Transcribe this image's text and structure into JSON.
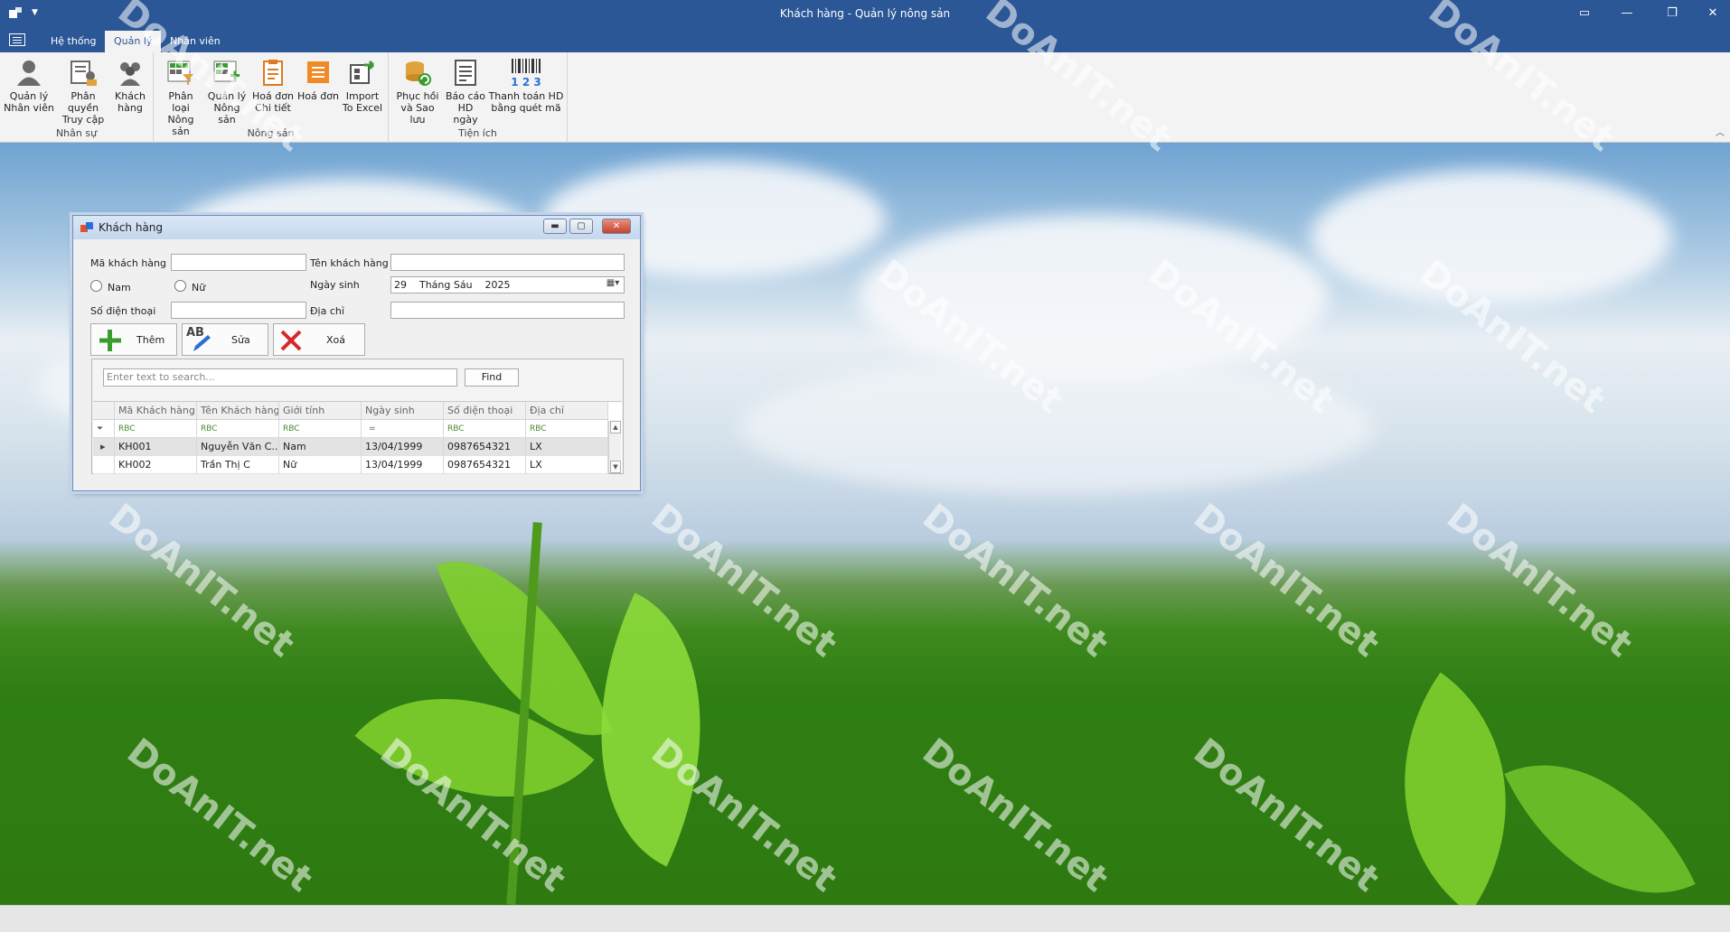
{
  "window": {
    "title": "Khách hàng - Quản lý nông sản",
    "controls": [
      "▭",
      "—",
      "❐",
      "✕"
    ]
  },
  "tabs": [
    {
      "label": "Hệ thống",
      "active": false
    },
    {
      "label": "Quản lý",
      "active": true
    },
    {
      "label": "Nhân viên",
      "active": false
    }
  ],
  "ribbon": {
    "groups": [
      {
        "label": "Nhân sự",
        "buttons": [
          {
            "line1": "Quản lý",
            "line2": "Nhân viên",
            "icon": "employee-icon"
          },
          {
            "line1": "Phân quyền",
            "line2": "Truy cập",
            "icon": "permission-icon"
          },
          {
            "line1": "Khách",
            "line2": "hàng",
            "icon": "customers-icon"
          }
        ]
      },
      {
        "label": "Nông sản",
        "buttons": [
          {
            "line1": "Phân loại",
            "line2": "Nông sản",
            "icon": "classify-icon"
          },
          {
            "line1": "Quản lý",
            "line2": "Nông sản",
            "icon": "manage-products-icon"
          },
          {
            "line1": "Hoá đơn",
            "line2": "Chi tiết",
            "icon": "invoice-detail-icon"
          },
          {
            "line1": "Hoá đơn",
            "line2": "",
            "icon": "invoice-icon"
          },
          {
            "line1": "Import",
            "line2": "To Excel",
            "icon": "import-excel-icon"
          }
        ]
      },
      {
        "label": "Tiện ích",
        "buttons": [
          {
            "line1": "Phục hồi",
            "line2": "và Sao lưu",
            "icon": "backup-restore-icon"
          },
          {
            "line1": "Báo cáo",
            "line2": "HD ngày",
            "icon": "report-icon"
          },
          {
            "line1": "Thanh toán HD",
            "line2": "bằng quét mã",
            "icon": "barcode-icon"
          }
        ]
      }
    ],
    "barcode_digits": "1 2 3"
  },
  "customer_form": {
    "title": "Khách hàng",
    "labels": {
      "ma_kh": "Mã khách hàng",
      "ten_kh": "Tên khách hàng",
      "ngay_sinh": "Ngày sinh",
      "sdt": "Số điện thoại",
      "dia_chi": "Địa chỉ"
    },
    "values": {
      "ma_kh": "",
      "ten_kh": "",
      "sdt": "",
      "dia_chi": "",
      "ngay_sinh": "29    Tháng Sáu    2025"
    },
    "gender": {
      "nam": "Nam",
      "nu": "Nữ",
      "selected": ""
    },
    "buttons": {
      "add": "Thêm",
      "edit": "Sửa",
      "delete": "Xoá"
    },
    "edit_icon_text": "AB",
    "search": {
      "placeholder": "Enter text to search...",
      "find_label": "Find"
    },
    "columns": [
      "Mã Khách hàng",
      "Tên Khách hàng",
      "Giới tính",
      "Ngày sinh",
      "Số điện thoại",
      "Địa chỉ"
    ],
    "filter_glyph": "RBC",
    "date_filter_glyph": "=",
    "rows": [
      {
        "ma": "KH001",
        "ten": "Nguyễn Văn C...",
        "gioi_tinh": "Nam",
        "ngay_sinh": "13/04/1999",
        "sdt": "0987654321",
        "dia_chi": "LX"
      },
      {
        "ma": "KH002",
        "ten": "Trần Thị C",
        "gioi_tinh": "Nữ",
        "ngay_sinh": "13/04/1999",
        "sdt": "0987654321",
        "dia_chi": "LX"
      }
    ]
  },
  "colors": {
    "titlebar": "#2b5797",
    "ribbon": "#f3f3f3",
    "delete_red": "#d42a2a",
    "add_green": "#3a9b2f"
  }
}
